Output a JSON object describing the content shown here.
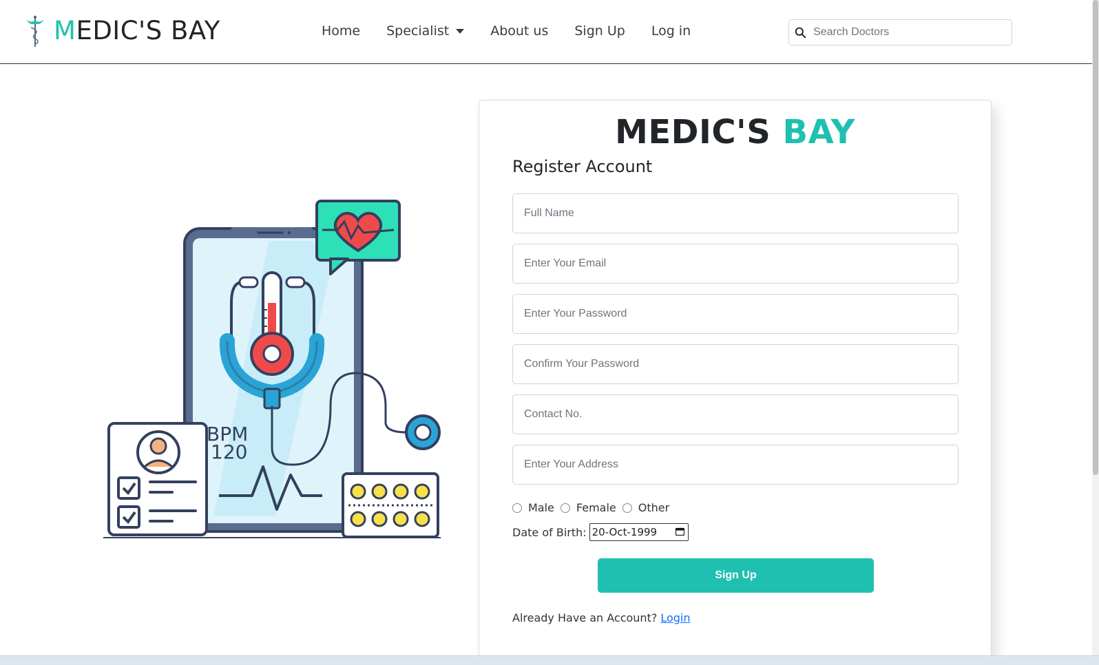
{
  "brand": {
    "initial": "M",
    "rest": "EDIC'S BAY"
  },
  "nav": {
    "home": "Home",
    "specialist": "Specialist",
    "about": "About us",
    "signup": "Sign Up",
    "login": "Log in"
  },
  "search": {
    "placeholder": "Search Doctors"
  },
  "illustration": {
    "bpm_label": "BPM",
    "bpm_value": "120"
  },
  "card": {
    "title_main": "MEDIC'S",
    "title_accent": "BAY",
    "heading": "Register Account"
  },
  "form": {
    "fullname_placeholder": "Full Name",
    "email_placeholder": "Enter Your Email",
    "password_placeholder": "Enter Your Password",
    "confirm_placeholder": "Confirm Your Password",
    "contact_placeholder": "Contact No.",
    "address_placeholder": "Enter Your Address",
    "gender_options": [
      "Male",
      "Female",
      "Other"
    ],
    "dob_label": "Date of Birth:",
    "dob_value": "20-Oct-1999",
    "submit_label": "Sign Up",
    "already_text": "Already Have an Account?",
    "login_link": "Login"
  },
  "colors": {
    "accent": "#20c0b0",
    "link": "#0d6efd",
    "text": "#212529"
  }
}
